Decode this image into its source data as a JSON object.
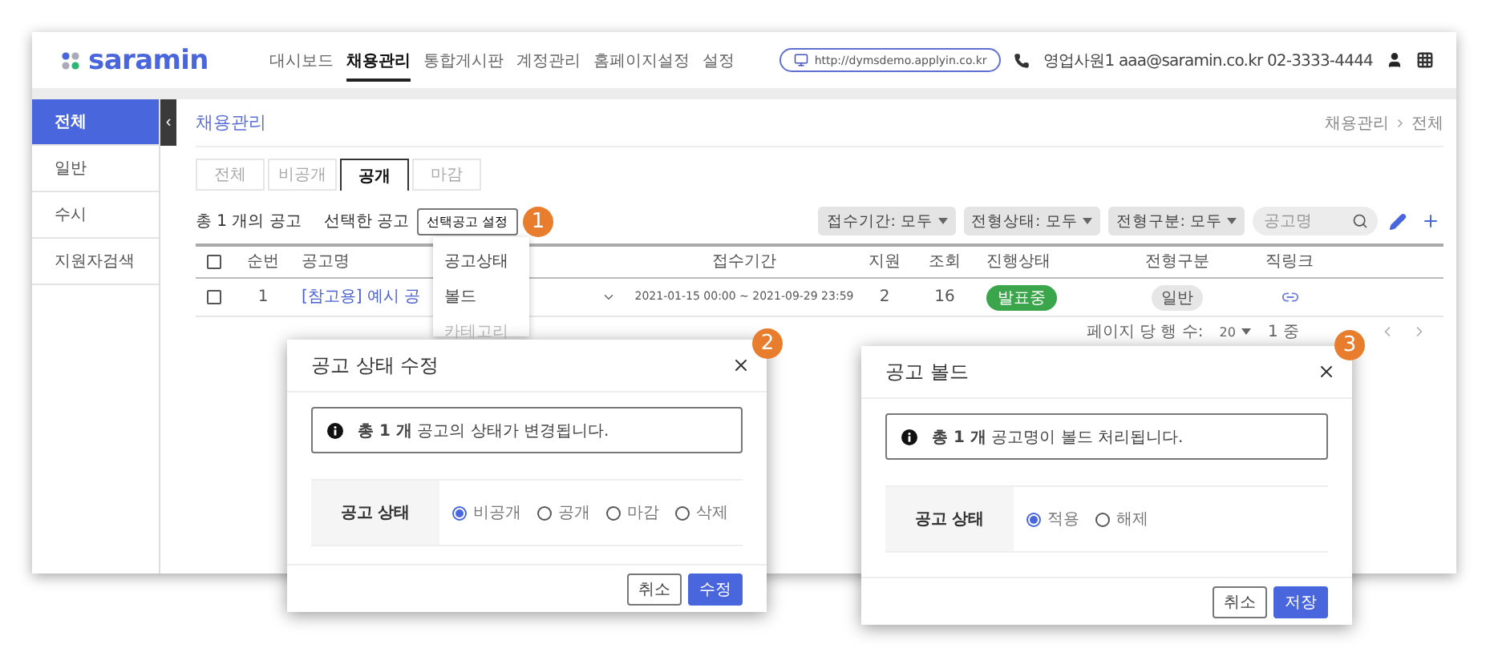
{
  "logo": {
    "text": "saramin"
  },
  "nav": [
    {
      "label": "대시보드",
      "selected": false
    },
    {
      "label": "채용관리",
      "selected": true
    },
    {
      "label": "통합게시판",
      "selected": false
    },
    {
      "label": "계정관리",
      "selected": false
    },
    {
      "label": "홈페이지설정",
      "selected": false
    },
    {
      "label": "설정",
      "selected": false
    }
  ],
  "url": "http://dymsdemo.applyin.co.kr",
  "contact": "영업사원1 aaa@saramin.co.kr 02-3333-4444",
  "sidebar": {
    "collapse_glyph": "‹",
    "items": [
      {
        "label": "전체",
        "selected": true
      },
      {
        "label": "일반",
        "selected": false
      },
      {
        "label": "수시",
        "selected": false
      },
      {
        "label": "지원자검색",
        "selected": false
      }
    ]
  },
  "page_title": "채용관리",
  "breadcrumb": [
    "채용관리",
    "전체"
  ],
  "tabs": [
    {
      "label": "전체",
      "selected": false
    },
    {
      "label": "비공개",
      "selected": false
    },
    {
      "label": "공개",
      "selected": true
    },
    {
      "label": "마감",
      "selected": false
    }
  ],
  "toolbar": {
    "count": "총 1 개의 공고",
    "selected_label": "선택한 공고",
    "action_button": "선택공고 설정",
    "marker": "1",
    "filters": [
      "접수기간: 모두",
      "전형상태: 모두",
      "전형구분: 모두"
    ],
    "search": {
      "placeholder": "공고명"
    }
  },
  "action_menu": {
    "items": [
      {
        "label": "공고상태",
        "disabled": false
      },
      {
        "label": "볼드",
        "disabled": false
      },
      {
        "label": "카테고리",
        "disabled": true
      }
    ]
  },
  "table": {
    "header_checked": false,
    "columns": [
      "순번",
      "공고명",
      "접수기간",
      "지원",
      "조회",
      "진행상태",
      "전형구분",
      "직링크"
    ],
    "rows": [
      {
        "checked": false,
        "number": "1",
        "title": "[참고용] 예시 공",
        "period": "2021-01-15 00:00 ~ 2021-09-29 23:59",
        "applicants": "2",
        "views": "16",
        "status": {
          "label": "발표중",
          "color": "#3aa54a"
        },
        "type": "일반"
      }
    ]
  },
  "pagination": {
    "rows_per_page_label": "페이지 당 행 수:",
    "rows_per_page": "20",
    "range": "1 중"
  },
  "dialogs": [
    {
      "title": "공고 상태 수정",
      "marker": "2",
      "message": "**총 1 개** 공고의 상태가 변경됩니다.",
      "field_label": "공고 상태",
      "options": [
        {
          "label": "비공개",
          "selected": true
        },
        {
          "label": "공개",
          "selected": false
        },
        {
          "label": "마감",
          "selected": false
        },
        {
          "label": "삭제",
          "selected": false
        }
      ],
      "buttons": [
        {
          "label": "취소",
          "kind": "secondary"
        },
        {
          "label": "수정",
          "kind": "primary"
        }
      ]
    },
    {
      "title": "공고 볼드",
      "marker": "3",
      "message": "**총 1 개** 공고명이 볼드 처리됩니다.",
      "field_label": "공고 상태",
      "options": [
        {
          "label": "적용",
          "selected": true
        },
        {
          "label": "해제",
          "selected": false
        }
      ],
      "buttons": [
        {
          "label": "취소",
          "kind": "secondary"
        },
        {
          "label": "저장",
          "kind": "primary"
        }
      ]
    }
  ]
}
